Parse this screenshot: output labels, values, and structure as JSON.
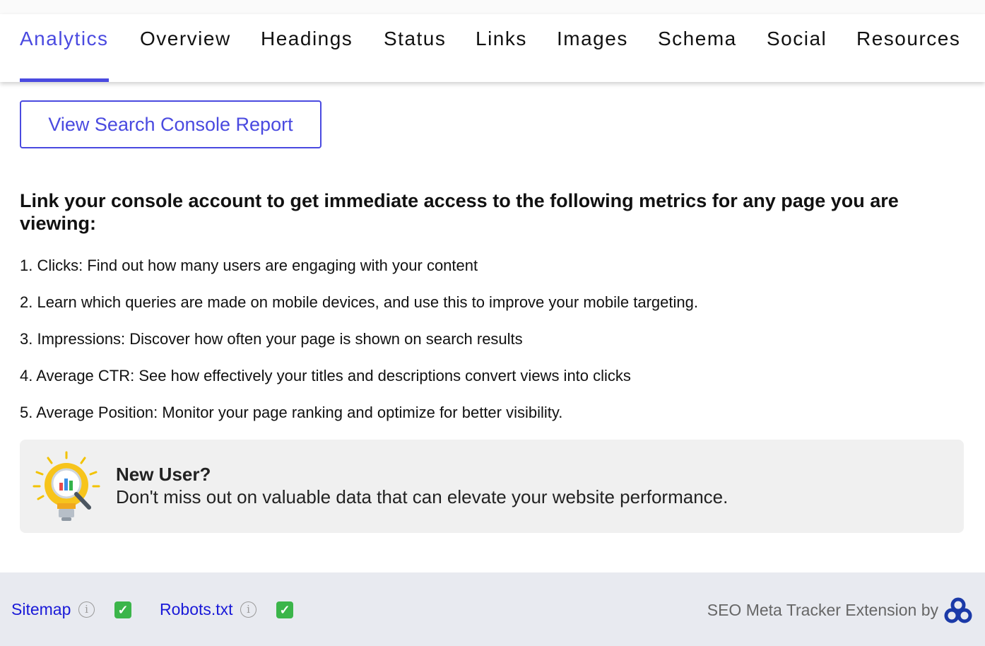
{
  "nav": {
    "tabs": [
      {
        "label": "Analytics",
        "active": true
      },
      {
        "label": "Overview",
        "active": false
      },
      {
        "label": "Headings",
        "active": false
      },
      {
        "label": "Status",
        "active": false
      },
      {
        "label": "Links",
        "active": false
      },
      {
        "label": "Images",
        "active": false
      },
      {
        "label": "Schema",
        "active": false
      },
      {
        "label": "Social",
        "active": false
      },
      {
        "label": "Resources",
        "active": false
      }
    ]
  },
  "main": {
    "console_button": "View Search Console Report",
    "headline": "Link your console account to get immediate access to the following metrics for any page you are viewing:",
    "metrics": [
      "1. Clicks: Find out how many users are engaging with your content",
      "2. Learn which queries are made on mobile devices, and use this to improve your mobile targeting.",
      "3. Impressions: Discover how often your page is shown on search results",
      "4. Average CTR: See how effectively your titles and descriptions convert views into clicks",
      "5. Average Position: Monitor your page ranking and optimize for better visibility."
    ],
    "new_user": {
      "icon": "lightbulb-chart-icon",
      "title": "New User?",
      "text": "Don't miss out on valuable data that can elevate your website performance."
    }
  },
  "footer": {
    "sitemap_label": "Sitemap",
    "sitemap_status": "✓",
    "robots_label": "Robots.txt",
    "robots_status": "✓",
    "info_glyph": "i",
    "credit": "SEO Meta Tracker Extension by",
    "brand_icon": "brand-logo-icon"
  },
  "colors": {
    "accent": "#4a4ae0",
    "link": "#1a1ad8",
    "check": "#3bb54a",
    "footer_bg": "#e8eaf0",
    "panel_bg": "#f0f0f0"
  }
}
